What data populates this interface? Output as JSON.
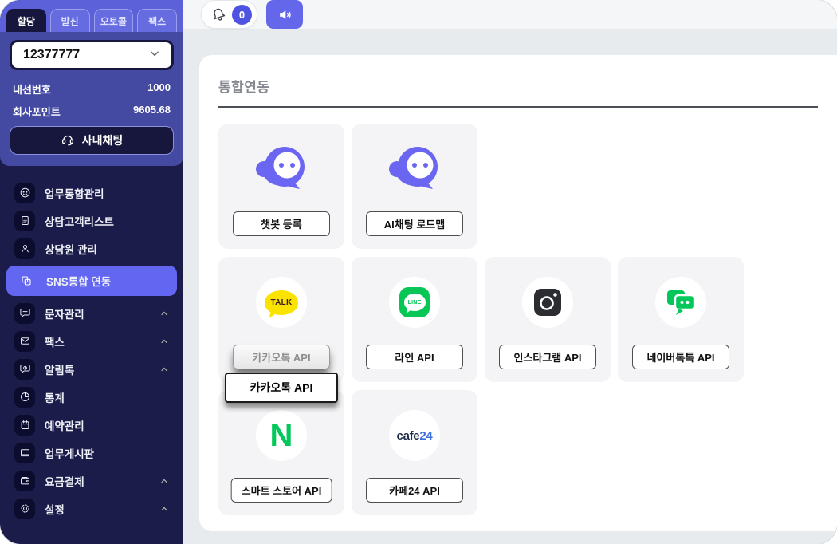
{
  "sidebar": {
    "tabs": [
      {
        "label": "할당",
        "active": true
      },
      {
        "label": "발신",
        "active": false
      },
      {
        "label": "오토콜",
        "active": false
      },
      {
        "label": "팩스",
        "active": false
      }
    ],
    "extension_select": {
      "value": "12377777"
    },
    "stats": [
      {
        "label": "내선번호",
        "value": "1000"
      },
      {
        "label": "회사포인트",
        "value": "9605.68"
      }
    ],
    "chat_button_label": "사내채팅",
    "menu": [
      {
        "label": "업무통합관리",
        "icon": "face-icon",
        "has_caret": false,
        "active": false
      },
      {
        "label": "상담고객리스트",
        "icon": "document-icon",
        "has_caret": false,
        "active": false
      },
      {
        "label": "상담원 관리",
        "icon": "person-icon",
        "has_caret": false,
        "active": false
      },
      {
        "label": "SNS통합 연동",
        "icon": "overlap-squares-icon",
        "has_caret": false,
        "active": true
      },
      {
        "label": "문자관리",
        "icon": "chat-bubble-icon",
        "has_caret": true,
        "active": false
      },
      {
        "label": "팩스",
        "icon": "envelope-icon",
        "has_caret": true,
        "active": false
      },
      {
        "label": "알림톡",
        "icon": "chat-clock-icon",
        "has_caret": true,
        "active": false
      },
      {
        "label": "통계",
        "icon": "pie-chart-icon",
        "has_caret": false,
        "active": false
      },
      {
        "label": "예약관리",
        "icon": "calendar-icon",
        "has_caret": false,
        "active": false
      },
      {
        "label": "업무게시판",
        "icon": "board-icon",
        "has_caret": false,
        "active": false
      },
      {
        "label": "요금결제",
        "icon": "wallet-icon",
        "has_caret": true,
        "active": false
      },
      {
        "label": "설정",
        "icon": "gear-icon",
        "has_caret": true,
        "active": false
      }
    ]
  },
  "topbar": {
    "notification_count": "0"
  },
  "main": {
    "title": "통합연동",
    "cards": [
      {
        "icon": "chatbot-icon",
        "button_label": "챗봇 등록"
      },
      {
        "icon": "chatbot-icon",
        "button_label": "AI채팅 로드맵"
      },
      {
        "icon": "kakaotalk-logo",
        "logo_text": "TALK",
        "button_label": "카카오톡 API",
        "disabled": true,
        "tooltip": "카카오톡 API"
      },
      {
        "icon": "line-logo",
        "logo_text": "LINE",
        "button_label": "라인 API"
      },
      {
        "icon": "instagram-logo",
        "button_label": "인스타그램 API"
      },
      {
        "icon": "navertalk-logo",
        "button_label": "네이버톡톡 API"
      },
      {
        "icon": "naver-logo",
        "logo_text": "N",
        "button_label": "스마트 스토어 API"
      },
      {
        "icon": "cafe24-logo",
        "logo_text_primary": "cafe",
        "logo_text_secondary": "24",
        "button_label": "카페24 API"
      }
    ]
  },
  "colors": {
    "accent_indigo": "#6366f1",
    "sidebar_navy": "#1c1c4a",
    "sidebar_block_blue": "#4449a2",
    "tabstrip_indigo": "#5c61da",
    "kakao_yellow": "#fbe300",
    "line_green": "#06c755",
    "naver_green": "#03c75a",
    "cafe24_blue": "#3a6ede"
  }
}
